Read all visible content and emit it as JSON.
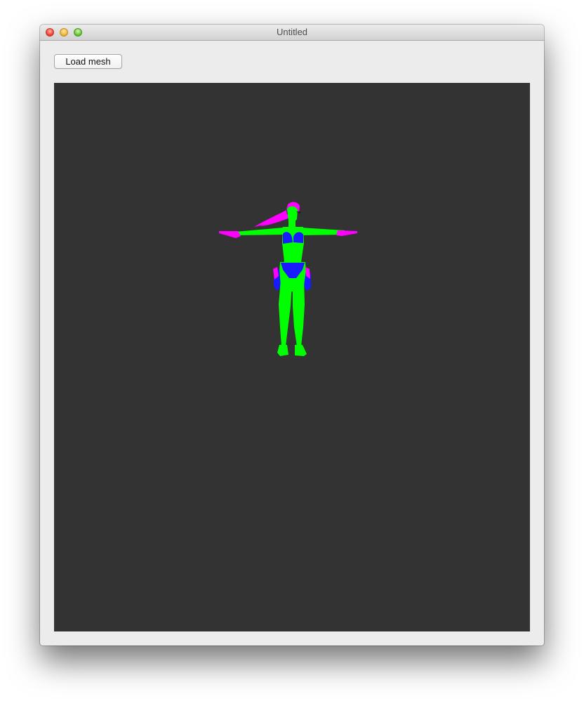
{
  "window": {
    "title": "Untitled"
  },
  "toolbar": {
    "load_mesh_label": "Load mesh"
  },
  "viewport": {
    "background_color": "#333333",
    "mesh_colors": {
      "skin": "#00ff00",
      "clothing": "#1a1aff",
      "hair": "#ff00ff"
    }
  }
}
